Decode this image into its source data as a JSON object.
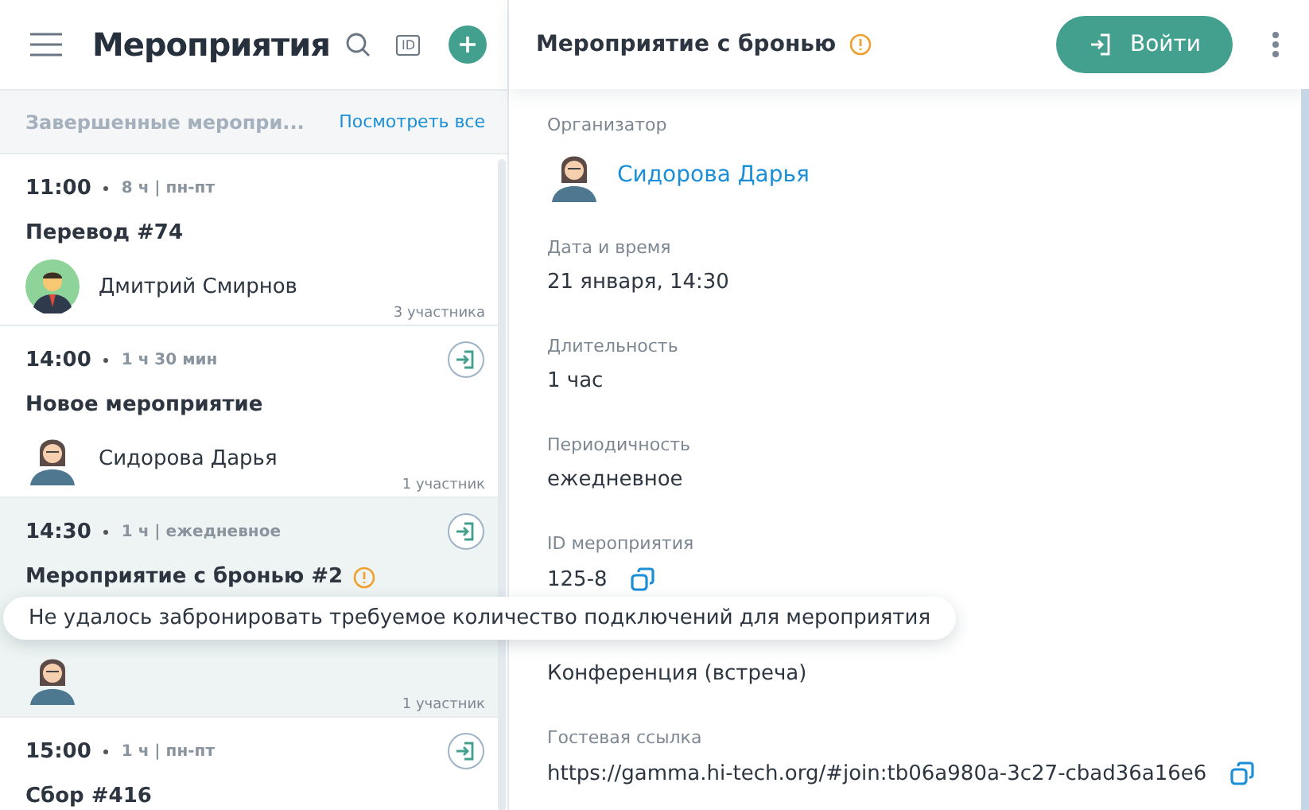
{
  "sidebar": {
    "title": "Мероприятия",
    "id_badge": "ID",
    "section": {
      "title": "Завершенные меропри...",
      "link": "Посмотреть все"
    },
    "events": [
      {
        "time": "11:00",
        "meta": "8 ч | пн-пт",
        "title": "Перевод #74",
        "warning": false,
        "organizer": "Дмитрий Смирнов",
        "avatar": {
          "kind": "male"
        },
        "participants": "3 участника",
        "join": false,
        "selected": false
      },
      {
        "time": "14:00",
        "meta": "1 ч 30 мин",
        "title": "Новое мероприятие",
        "warning": false,
        "organizer": "Сидорова Дарья",
        "avatar": {
          "kind": "female"
        },
        "participants": "1 участник",
        "join": true,
        "selected": false
      },
      {
        "time": "14:30",
        "meta": "1 ч | ежедневное",
        "title": "Мероприятие с бронью #2",
        "warning": true,
        "avatar": {
          "kind": "female"
        },
        "participants": "1 участник",
        "join": true,
        "selected": true
      },
      {
        "time": "15:00",
        "meta": "1 ч | пн-пт",
        "title": "Сбор #416",
        "warning": false,
        "join": true,
        "selected": false
      }
    ]
  },
  "tooltip": "Не удалось забронировать требуемое количество подключений для мероприятия",
  "detail": {
    "title": "Мероприятие с бронью",
    "warning": true,
    "join_button": "Войти",
    "fields": [
      {
        "kind": "person",
        "label": "Организатор",
        "value": "Сидорова Дарья"
      },
      {
        "kind": "text",
        "label": "Дата и время",
        "value": "21 января, 14:30"
      },
      {
        "kind": "text",
        "label": "Длительность",
        "value": "1 час"
      },
      {
        "kind": "text",
        "label": "Периодичность",
        "value": "ежедневное"
      },
      {
        "kind": "copy",
        "label": "ID мероприятия",
        "value": "125-8"
      },
      {
        "kind": "text",
        "value": "Конференция (встреча)"
      },
      {
        "kind": "copy",
        "label": "Гостевая ссылка",
        "value": "https://gamma.hi-tech.org/#join:tb06a980a-3c27-cbad36a16e6"
      }
    ]
  }
}
